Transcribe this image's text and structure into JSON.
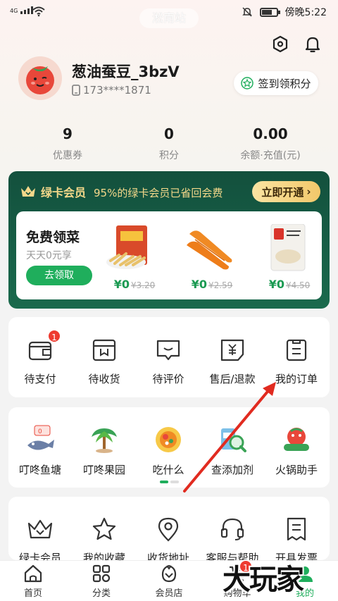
{
  "status_bar": {
    "network": "4G",
    "time": "傍晚5:22"
  },
  "station_name": "淞南站",
  "user": {
    "name": "葱油蚕豆_3bzV",
    "phone": "173****1871"
  },
  "checkin_label": "签到领积分",
  "stats": [
    {
      "value": "9",
      "label": "优惠券"
    },
    {
      "value": "0",
      "label": "积分"
    },
    {
      "value": "0.00",
      "label": "余额·充值(元)"
    }
  ],
  "vip": {
    "badge": "绿卡会员",
    "slogan": "95%的绿卡会员已省回会费",
    "open_label": "立即开通",
    "free_title": "免费领菜",
    "free_sub": "天天0元享",
    "claim_label": "去领取",
    "products": [
      {
        "price": "¥0",
        "original": "¥3.20"
      },
      {
        "price": "¥0",
        "original": "¥2.59"
      },
      {
        "price": "¥0",
        "original": "¥4.50"
      }
    ]
  },
  "orders": [
    {
      "label": "待支付",
      "icon": "wallet-icon",
      "badge": "1"
    },
    {
      "label": "待收货",
      "icon": "package-icon"
    },
    {
      "label": "待评价",
      "icon": "comment-icon"
    },
    {
      "label": "售后/退款",
      "icon": "refund-icon"
    },
    {
      "label": "我的订单",
      "icon": "order-list-icon"
    }
  ],
  "tools": [
    {
      "label": "叮咚鱼塘",
      "icon": "fish-pond-icon"
    },
    {
      "label": "叮咚果园",
      "icon": "orchard-icon"
    },
    {
      "label": "吃什么",
      "icon": "food-bowl-icon"
    },
    {
      "label": "查添加剂",
      "icon": "additive-check-icon"
    },
    {
      "label": "火锅助手",
      "icon": "hotpot-icon"
    }
  ],
  "services": [
    {
      "label": "绿卡会员",
      "icon": "crown-icon"
    },
    {
      "label": "我的收藏",
      "icon": "star-icon"
    },
    {
      "label": "收货地址",
      "icon": "location-icon"
    },
    {
      "label": "客服与帮助",
      "icon": "headset-icon"
    },
    {
      "label": "开具发票",
      "icon": "invoice-icon"
    }
  ],
  "tabs": [
    {
      "label": "首页",
      "icon": "home-icon"
    },
    {
      "label": "分类",
      "icon": "category-icon"
    },
    {
      "label": "会员店",
      "icon": "member-store-icon"
    },
    {
      "label": "购物车",
      "icon": "cart-icon",
      "badge": "1"
    },
    {
      "label": "我的",
      "icon": "profile-icon"
    }
  ],
  "watermark": "大玩家",
  "colors": {
    "brand_green": "#1fae5c",
    "vip_dark": "#13503d",
    "badge_red": "#ee3b30",
    "gold": "#f4d88a",
    "arrow_red": "#e12b20"
  }
}
